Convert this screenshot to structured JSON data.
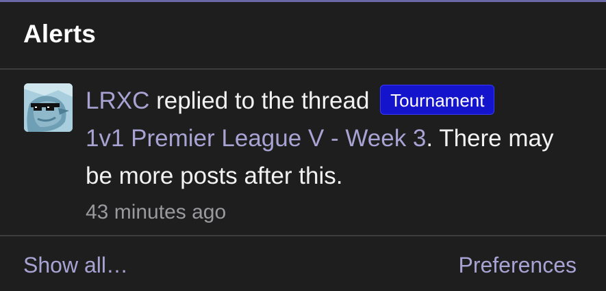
{
  "header": {
    "title": "Alerts"
  },
  "alerts": [
    {
      "user": "LRXC",
      "action": " replied to the thread ",
      "prefix_badge": "Tournament",
      "thread_title": "1v1 Premier League V - Week 3",
      "suffix": ". There may be more posts after this.",
      "time": "43 minutes ago",
      "avatar_icon": "bird-with-sunglasses-avatar"
    }
  ],
  "footer": {
    "show_all": "Show all…",
    "preferences": "Preferences"
  },
  "colors": {
    "background": "#1e1e1f",
    "accent_border": "#6b68a8",
    "link": "#a8a3d3",
    "badge": "#1414cc",
    "divider": "#3d3d3f",
    "muted": "#9a9a9e"
  }
}
